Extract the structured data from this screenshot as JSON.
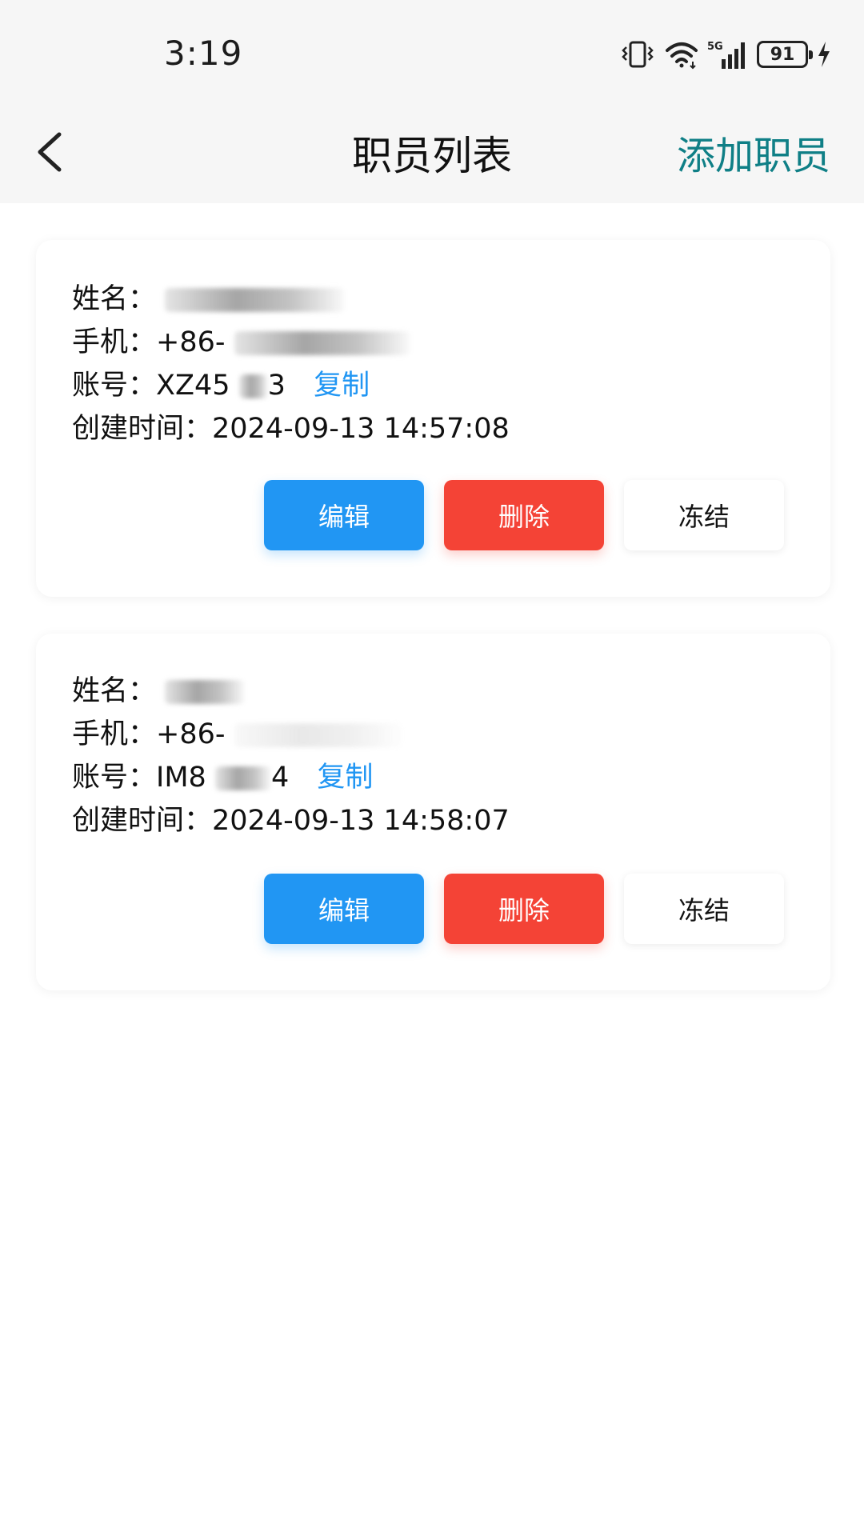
{
  "status_bar": {
    "time": "3:19",
    "battery": "91",
    "network": "5G",
    "icons": [
      "vibrate-icon",
      "wifi-icon",
      "signal-5g-icon",
      "battery-icon",
      "charging-icon"
    ]
  },
  "nav": {
    "title": "职员列表",
    "action_label": "添加职员",
    "back_icon": "chevron-left-icon",
    "action_color": "#0f7f86"
  },
  "labels": {
    "name": "姓名：",
    "phone": "手机：",
    "account": "账号：",
    "created": "创建时间：",
    "copy": "复制",
    "edit": "编辑",
    "delete": "删除",
    "freeze": "冻结"
  },
  "employees": [
    {
      "phone_prefix": "+86-",
      "account_start": "XZ45",
      "account_end": "3",
      "created_at": "2024-09-13 14:57:08"
    },
    {
      "phone_prefix": "+86-",
      "account_start": "IM8",
      "account_end": "4",
      "created_at": "2024-09-13 14:58:07"
    }
  ],
  "colors": {
    "edit": "#2196f3",
    "delete": "#f44336",
    "freeze": "#ffffff",
    "copy_link": "#2196f3"
  }
}
